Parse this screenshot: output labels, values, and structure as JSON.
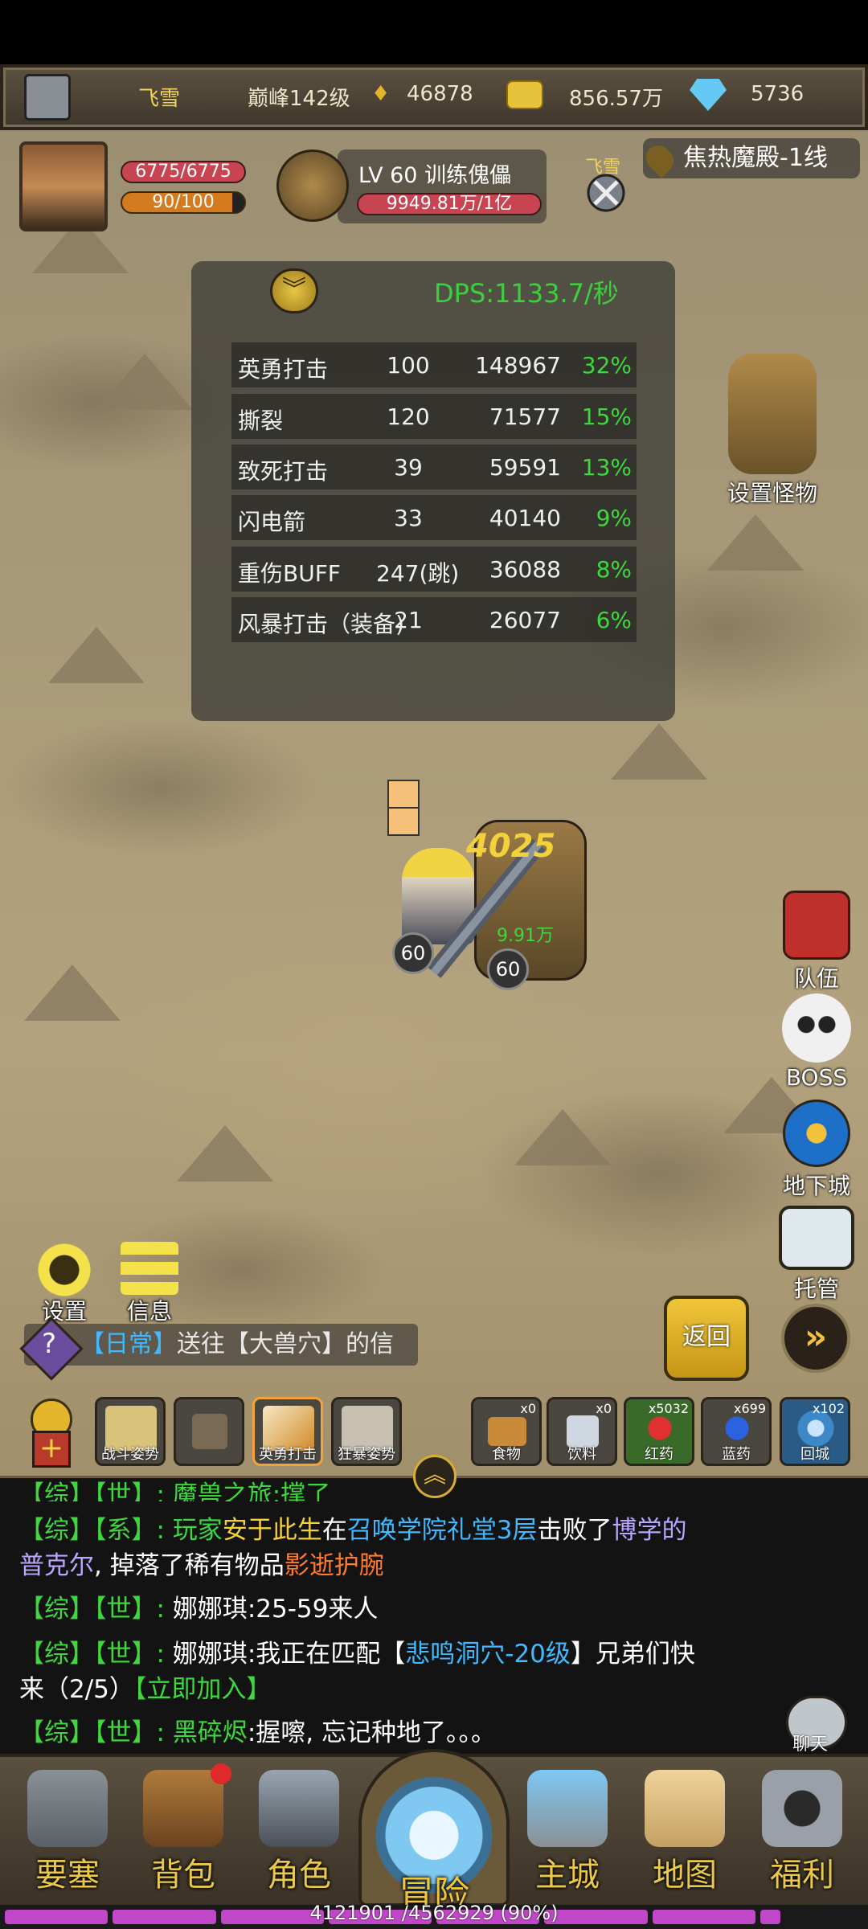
{
  "status_bar": {
    "player_name": "飞雪",
    "rank": "巅峰142级",
    "honor": "46878",
    "gold": "856.57万",
    "diamonds": "5736"
  },
  "hero": {
    "hp": "6775/6775",
    "mp": "90/100",
    "mp_fraction": 0.9
  },
  "target": {
    "title": "LV 60 训练傀儡",
    "hp": "9949.81万/1亿",
    "pvp_name": "飞雪",
    "location": "焦热魔殿-1线"
  },
  "dps_panel": {
    "title": "DPS:1133.7/秒",
    "rows": [
      {
        "skill": "英勇打击",
        "count": "100",
        "damage": "148967",
        "pct": "32%"
      },
      {
        "skill": "撕裂",
        "count": "120",
        "damage": "71577",
        "pct": "15%"
      },
      {
        "skill": "致死打击",
        "count": "39",
        "damage": "59591",
        "pct": "13%"
      },
      {
        "skill": "闪电箭",
        "count": "33",
        "damage": "40140",
        "pct": "9%"
      },
      {
        "skill": "重伤BUFF",
        "count": "247(跳)",
        "damage": "36088",
        "pct": "8%"
      },
      {
        "skill": "风暴打击（装备)",
        "count": "21",
        "damage": "26077",
        "pct": "6%"
      }
    ]
  },
  "side_menu": {
    "set_monster": "设置怪物",
    "team": "队伍",
    "boss": "BOSS",
    "dungeon": "地下城",
    "auto": "托管"
  },
  "battle": {
    "hero_level": "60",
    "golem_level": "60",
    "golem_hp_text": "9.91万",
    "damage_numbers": "4025"
  },
  "controls": {
    "settings": "设置",
    "info": "信息",
    "quest_tag": "【日常】",
    "quest_text": "送往【大兽穴】的信",
    "return": "返回"
  },
  "skill_bar": {
    "stances": [
      {
        "label": "战斗姿势"
      },
      {
        "label": ""
      },
      {
        "label": "英勇打击"
      },
      {
        "label": "狂暴姿势"
      }
    ],
    "items": [
      {
        "label": "食物",
        "count": "x0"
      },
      {
        "label": "饮料",
        "count": "x0"
      },
      {
        "label": "红药",
        "count": "x5032"
      },
      {
        "label": "蓝药",
        "count": "x699"
      },
      {
        "label": "回城",
        "count": "x102"
      }
    ]
  },
  "chat": {
    "line0": "【综】【世】: 魔兽之旅:撑了",
    "line1_prefix": "【综】【系】: 玩家",
    "line1_player": "安于此生",
    "line1_mid": "在",
    "line1_place": "召唤学院礼堂3层",
    "line1_mid2": "击败了",
    "line1_boss1": "博学的",
    "line1_boss2": "普克尔",
    "line1_mid3": ", 掉落了稀有物品",
    "line1_item": "影逝护腕",
    "line2_prefix": "【综】【世】: ",
    "line2_name": "娜娜琪",
    "line2_text": ":25-59来人",
    "line3_prefix": "【综】【世】: ",
    "line3_name": "娜娜琪",
    "line3_text1": ":我正在匹配【",
    "line3_dungeon": "悲鸣洞穴-20级",
    "line3_text2": "】兄弟们快",
    "line3_text3": "来（2/5）",
    "line3_join": "【立即加入】",
    "line4_prefix": "【综】【世】: ",
    "line4_name": "黑碎烬",
    "line4_text": ":握嚓, 忘记种地了。。。",
    "chat_button": "聊天"
  },
  "nav": {
    "fortress": "要塞",
    "bag": "背包",
    "character": "角色",
    "adventure": "冒险",
    "main_city": "主城",
    "map": "地图",
    "welfare": "福利"
  },
  "xp": {
    "text": "4121901 /4562929 (90%)",
    "fraction": 0.9
  }
}
